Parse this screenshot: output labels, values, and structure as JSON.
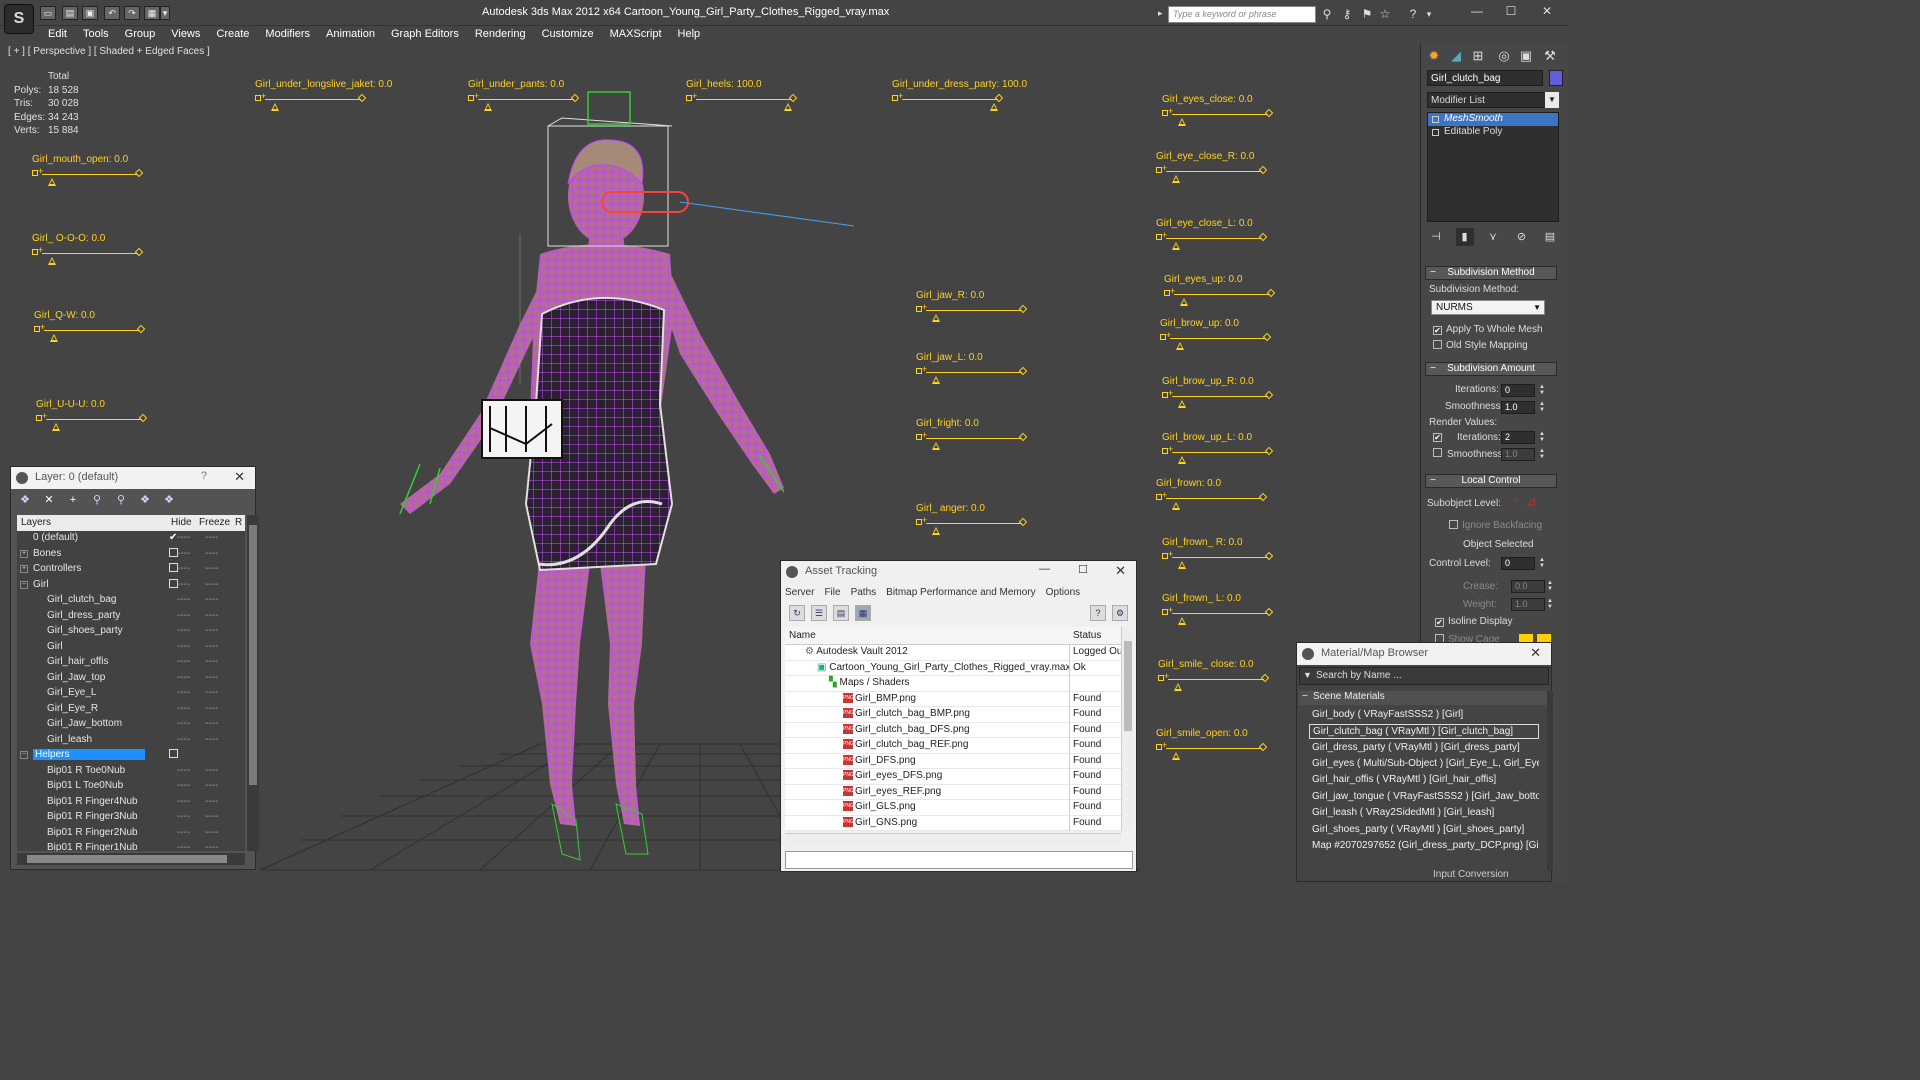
{
  "window": {
    "title": "Autodesk 3ds Max  2012 x64      Cartoon_Young_Girl_Party_Clothes_Rigged_vray.max",
    "search_placeholder": "Type a keyword or phrase"
  },
  "menus": [
    "Edit",
    "Tools",
    "Group",
    "Views",
    "Create",
    "Modifiers",
    "Animation",
    "Graph Editors",
    "Rendering",
    "Customize",
    "MAXScript",
    "Help"
  ],
  "viewport": {
    "label": "[ + ] [ Perspective ] [ Shaded + Edged Faces ]",
    "stats": {
      "header": "Total",
      "rows": [
        {
          "label": "Polys:",
          "value": "18 528"
        },
        {
          "label": "Tris:",
          "value": "30 028"
        },
        {
          "label": "Edges:",
          "value": "34 243"
        },
        {
          "label": "Verts:",
          "value": "15 884"
        }
      ]
    }
  },
  "sliders": [
    {
      "label": "Girl_mouth_open: 0.0",
      "value": 0.0
    },
    {
      "label": "Girl_ O-O-O: 0.0",
      "value": 0.0
    },
    {
      "label": "Girl_Q-W: 0.0",
      "value": 0.0
    },
    {
      "label": "Girl_U-U-U: 0.0",
      "value": 0.0
    },
    {
      "label": "Girl_under_longslive_jaket: 0.0",
      "value": 0.0
    },
    {
      "label": "Girl_under_pants: 0.0",
      "value": 0.0
    },
    {
      "label": "Girl_heels: 100.0",
      "value": 100.0
    },
    {
      "label": "Girl_under_dress_party: 100.0",
      "value": 100.0
    },
    {
      "label": "Girl_jaw_R: 0.0",
      "value": 0.0
    },
    {
      "label": "Girl_jaw_L: 0.0",
      "value": 0.0
    },
    {
      "label": "Girl_fright: 0.0",
      "value": 0.0
    },
    {
      "label": "Girl_ anger: 0.0",
      "value": 0.0
    },
    {
      "label": "Girl_eyes_close: 0.0",
      "value": 0.0
    },
    {
      "label": "Girl_eye_close_R: 0.0",
      "value": 0.0
    },
    {
      "label": "Girl_eye_close_L: 0.0",
      "value": 0.0
    },
    {
      "label": "Girl_eyes_up: 0.0",
      "value": 0.0
    },
    {
      "label": "Girl_brow_up: 0.0",
      "value": 0.0
    },
    {
      "label": "Girl_brow_up_R: 0.0",
      "value": 0.0
    },
    {
      "label": "Girl_brow_up_L: 0.0",
      "value": 0.0
    },
    {
      "label": "Girl_frown: 0.0",
      "value": 0.0
    },
    {
      "label": "Girl_frown_ R: 0.0",
      "value": 0.0
    },
    {
      "label": "Girl_frown_ L: 0.0",
      "value": 0.0
    },
    {
      "label": "Girl_smile_ close: 0.0",
      "value": 0.0
    },
    {
      "label": "Girl_smile_open: 0.0",
      "value": 0.0
    }
  ],
  "layer_panel": {
    "title": "Layer: 0 (default)",
    "help": "?",
    "columns": {
      "name": "Layers",
      "hide": "Hide",
      "freeze": "Freeze",
      "render": "R"
    },
    "rows": [
      {
        "name": "0 (default)",
        "type": "layer",
        "check": "✔"
      },
      {
        "name": "Bones",
        "type": "layer"
      },
      {
        "name": "Controllers",
        "type": "layer"
      },
      {
        "name": "Girl",
        "type": "layer"
      },
      {
        "name": "Girl_clutch_bag",
        "type": "object"
      },
      {
        "name": "Girl_dress_party",
        "type": "object"
      },
      {
        "name": "Girl_shoes_party",
        "type": "object"
      },
      {
        "name": "Girl",
        "type": "object"
      },
      {
        "name": "Girl_hair_offis",
        "type": "object"
      },
      {
        "name": "Girl_Jaw_top",
        "type": "object"
      },
      {
        "name": "Girl_Eye_L",
        "type": "object"
      },
      {
        "name": "Girl_Eye_R",
        "type": "object"
      },
      {
        "name": "Girl_Jaw_bottom",
        "type": "object"
      },
      {
        "name": "Girl_leash",
        "type": "object"
      },
      {
        "name": "Helpers",
        "type": "layer",
        "selected": true
      },
      {
        "name": "Bip01 R Toe0Nub",
        "type": "object"
      },
      {
        "name": "Bip01 L Toe0Nub",
        "type": "object"
      },
      {
        "name": "Bip01 R Finger4Nub",
        "type": "object"
      },
      {
        "name": "Bip01 R Finger3Nub",
        "type": "object"
      },
      {
        "name": "Bip01 R Finger2Nub",
        "type": "object"
      },
      {
        "name": "Bip01 R Finger1Nub",
        "type": "object"
      }
    ]
  },
  "asset_tracking": {
    "title": "Asset Tracking",
    "menus": [
      "Server",
      "File",
      "Paths",
      "Bitmap Performance and Memory",
      "Options"
    ],
    "columns": {
      "name": "Name",
      "status": "Status"
    },
    "rows": [
      {
        "name": "Autodesk Vault 2012",
        "status": "Logged Ou",
        "indent": 1,
        "icon": "vault"
      },
      {
        "name": "Cartoon_Young_Girl_Party_Clothes_Rigged_vray.max",
        "status": "Ok",
        "indent": 2,
        "icon": "max"
      },
      {
        "name": "Maps / Shaders",
        "status": "",
        "indent": 3,
        "icon": "maps"
      },
      {
        "name": "Girl_BMP.png",
        "status": "Found",
        "indent": 4,
        "icon": "png"
      },
      {
        "name": "Girl_clutch_bag_BMP.png",
        "status": "Found",
        "indent": 4,
        "icon": "png"
      },
      {
        "name": "Girl_clutch_bag_DFS.png",
        "status": "Found",
        "indent": 4,
        "icon": "png"
      },
      {
        "name": "Girl_clutch_bag_REF.png",
        "status": "Found",
        "indent": 4,
        "icon": "png"
      },
      {
        "name": "Girl_DFS.png",
        "status": "Found",
        "indent": 4,
        "icon": "png"
      },
      {
        "name": "Girl_eyes_DFS.png",
        "status": "Found",
        "indent": 4,
        "icon": "png"
      },
      {
        "name": "Girl_eyes_REF.png",
        "status": "Found",
        "indent": 4,
        "icon": "png"
      },
      {
        "name": "Girl_GLS.png",
        "status": "Found",
        "indent": 4,
        "icon": "png"
      },
      {
        "name": "Girl_GNS.png",
        "status": "Found",
        "indent": 4,
        "icon": "png"
      }
    ]
  },
  "command_panel": {
    "object_name": "Girl_clutch_bag",
    "modifier_list": "Modifier List",
    "stack": [
      {
        "name": "MeshSmooth",
        "selected": true
      },
      {
        "name": "Editable Poly",
        "selected": false
      }
    ],
    "rollouts": {
      "subdivision_method": {
        "title": "Subdivision Method",
        "label": "Subdivision Method:",
        "value": "NURMS",
        "apply_whole_mesh": "Apply To Whole Mesh",
        "old_style": "Old Style Mapping"
      },
      "subdivision_amount": {
        "title": "Subdivision Amount",
        "iterations_label": "Iterations:",
        "iterations": "0",
        "smoothness_label": "Smoothness:",
        "smoothness": "1.0",
        "render_values": "Render Values:",
        "r_iterations_label": "Iterations:",
        "r_iterations": "2",
        "r_smoothness_label": "Smoothness:",
        "r_smoothness": "1.0"
      },
      "local_control": {
        "title": "Local Control",
        "subobject_label": "Subobject Level:",
        "ignore_backfacing": "Ignore Backfacing",
        "object_selected": "Object Selected",
        "control_level_label": "Control Level:",
        "control_level": "0",
        "crease_label": "Crease:",
        "crease": "0.0",
        "weight_label": "Weight:",
        "weight": "1.0",
        "isoline": "Isoline Display",
        "show_cage": "Show Cage"
      }
    }
  },
  "material_browser": {
    "title": "Material/Map Browser",
    "search": "Search by Name ...",
    "group": "Scene Materials",
    "items": [
      {
        "text": "Girl_body  ( VRayFastSSS2 ) [Girl]",
        "selected": false
      },
      {
        "text": "Girl_clutch_bag  ( VRayMtl ) [Girl_clutch_bag]",
        "selected": true
      },
      {
        "text": "Girl_dress_party  ( VRayMtl ) [Girl_dress_party]",
        "selected": false
      },
      {
        "text": "Girl_eyes  ( Multi/Sub-Object ) [Girl_Eye_L, Girl_Eye...",
        "selected": false
      },
      {
        "text": "Girl_hair_offis  ( VRayMtl ) [Girl_hair_offis]",
        "selected": false
      },
      {
        "text": "Girl_jaw_tongue  ( VRayFastSSS2 ) [Girl_Jaw_botto...",
        "selected": false
      },
      {
        "text": "Girl_leash  ( VRay2SidedMtl ) [Girl_leash]",
        "selected": false
      },
      {
        "text": "Girl_shoes_party  ( VRayMtl ) [Girl_shoes_party]",
        "selected": false
      },
      {
        "text": "Map #2070297652 (Girl_dress_party_DCP.png) [Girl...",
        "selected": false
      }
    ],
    "footer": "Input Conversion"
  },
  "colors": {
    "slider": "#ffd21f",
    "wire": "#c040ff",
    "selection": "#1e90ff"
  }
}
